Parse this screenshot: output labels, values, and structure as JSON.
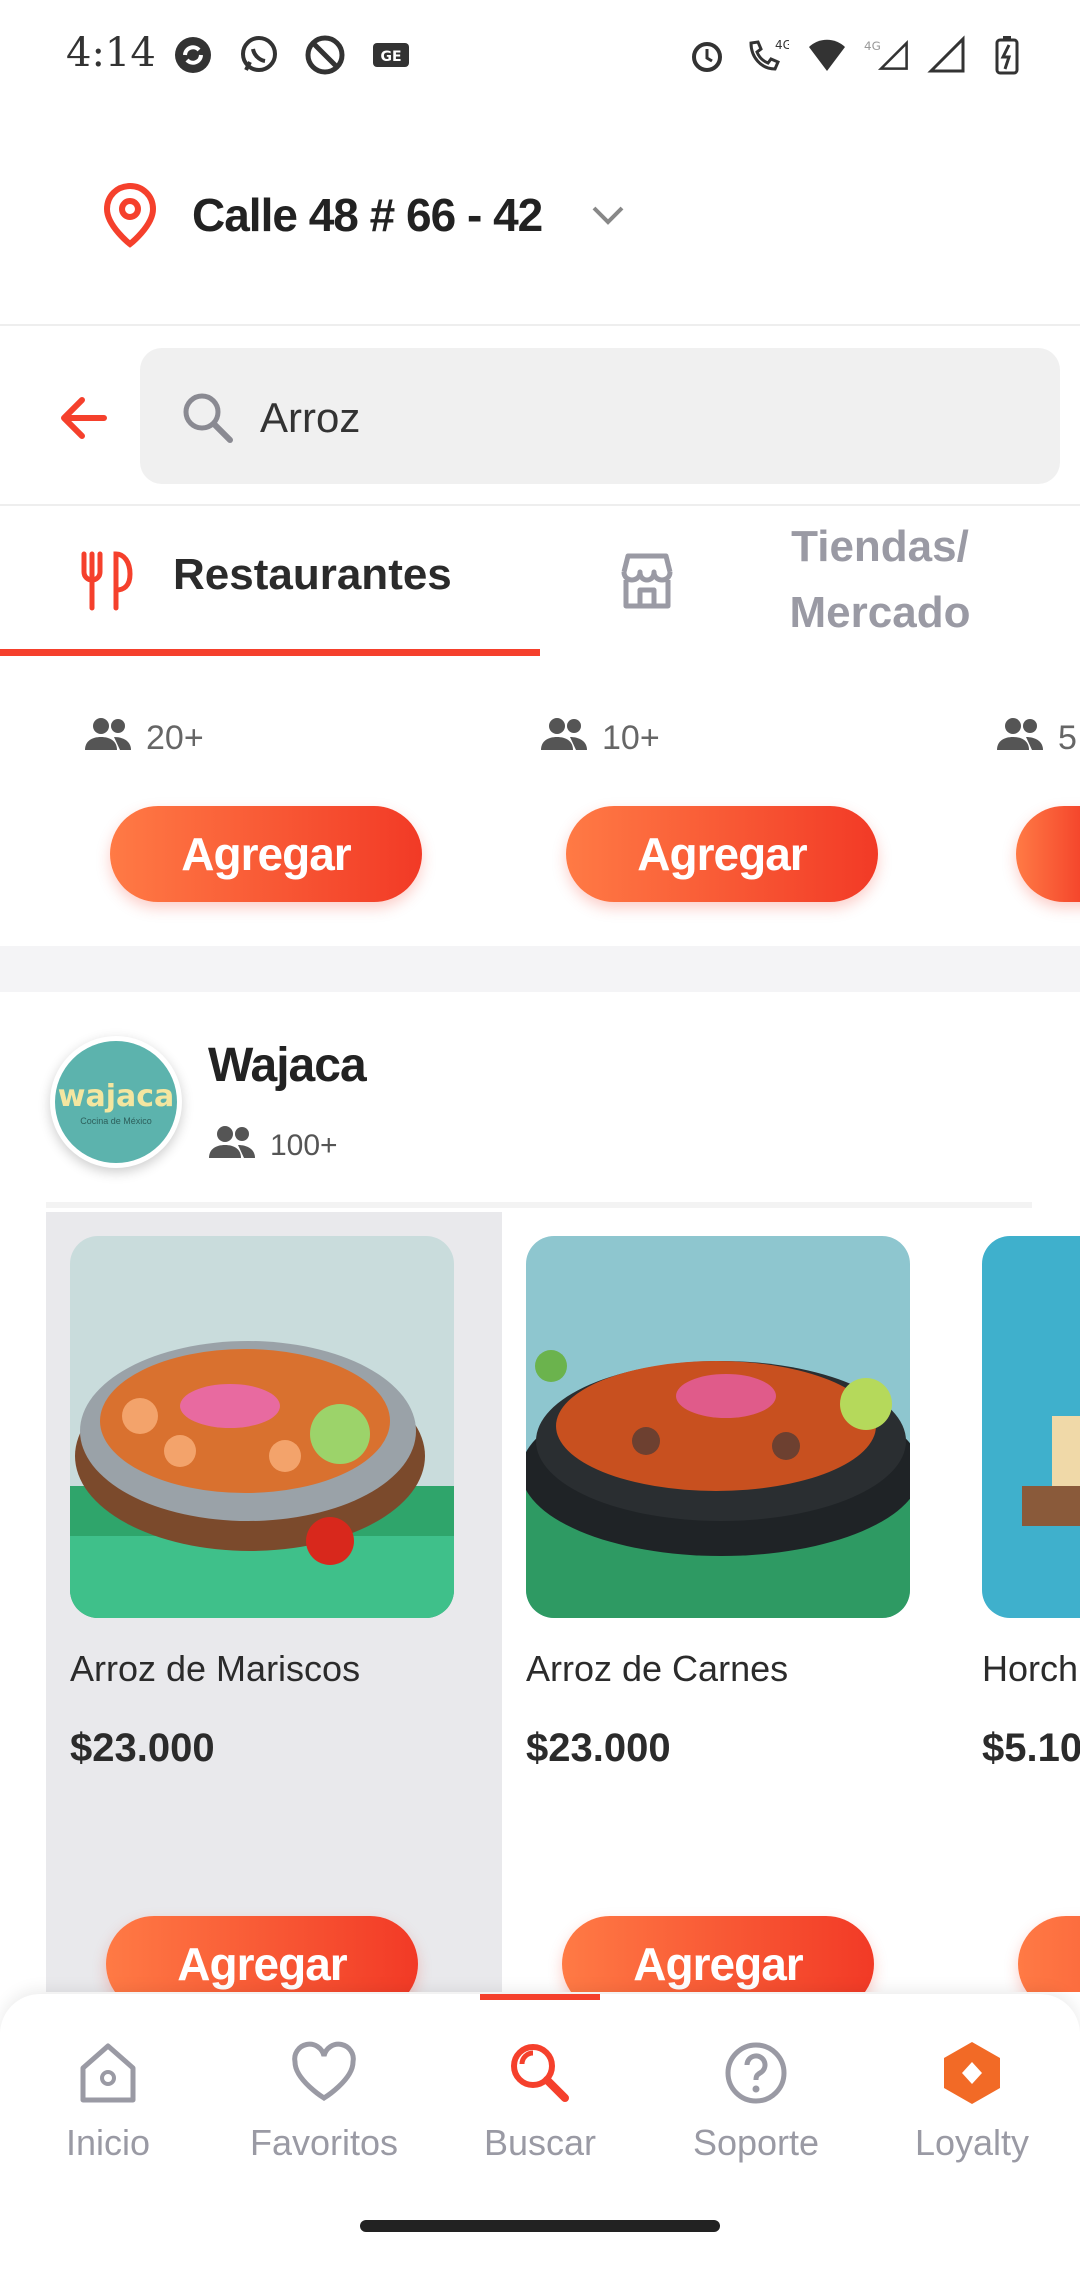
{
  "status_bar": {
    "time": "4:14"
  },
  "header": {
    "address": "Calle 48 # 66 - 42"
  },
  "search": {
    "query": "Arroz"
  },
  "tabs": [
    {
      "label": "Restaurantes"
    },
    {
      "label": "Tiendas/ Mercado"
    }
  ],
  "previous_restaurant": {
    "items": [
      {
        "orders": "20+",
        "button": "Agregar"
      },
      {
        "orders": "10+",
        "button": "Agregar"
      },
      {
        "orders": "5"
      }
    ]
  },
  "restaurant": {
    "name": "Wajaca",
    "logo_text": "wajaca",
    "logo_subtext": "Cocina de México",
    "orders": "100+",
    "products": [
      {
        "name": "Arroz de Mariscos",
        "price": "$23.000",
        "button": "Agregar"
      },
      {
        "name": "Arroz de Carnes",
        "price": "$23.000",
        "button": "Agregar"
      },
      {
        "name": "Horch",
        "price": "$5.10"
      }
    ]
  },
  "bottom_nav": [
    {
      "label": "Inicio",
      "icon": "home-icon"
    },
    {
      "label": "Favoritos",
      "icon": "heart-icon"
    },
    {
      "label": "Buscar",
      "icon": "search-icon"
    },
    {
      "label": "Soporte",
      "icon": "help-icon"
    },
    {
      "label": "Loyalty",
      "icon": "loyalty-icon"
    }
  ],
  "colors": {
    "accent": "#f5402c",
    "inactive": "#9a9aa4",
    "logo_teal": "#5cb3ad"
  }
}
